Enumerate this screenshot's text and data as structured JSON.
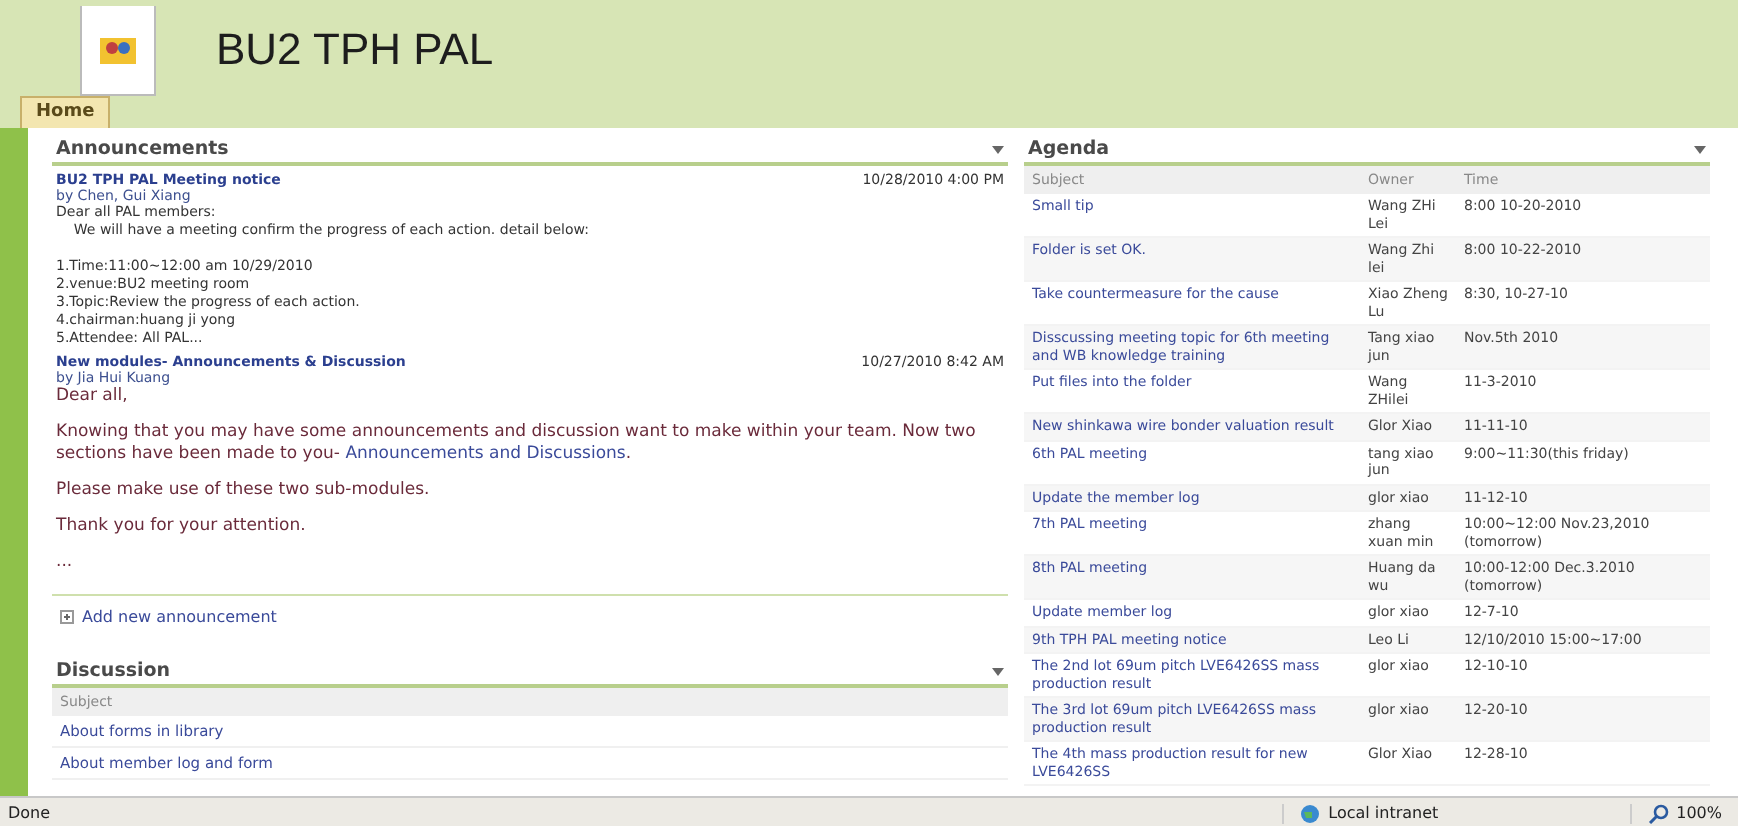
{
  "site": {
    "title": "BU2 TPH PAL"
  },
  "tabs": [
    {
      "label": "Home",
      "selected": true
    }
  ],
  "announcements": {
    "title": "Announcements",
    "items": [
      {
        "title": "BU2 TPH PAL Meeting notice",
        "date": "10/28/2010 4:00 PM",
        "author": "by Chen, Gui Xiang",
        "kind": "small",
        "body": [
          [
            "Dear all PAL members:",
            "    We will have a meeting confirm the progress of each action. detail below:"
          ],
          [
            "1.Time:11:00~12:00 am 10/29/2010",
            "2.venue:BU2 meeting room",
            "3.Topic:Review the progress of each action.",
            "4.chairman:huang ji yong",
            "5.Attendee: All PAL..."
          ]
        ]
      },
      {
        "title": "New modules- Announcements & Discussion",
        "date": "10/27/2010 8:42 AM",
        "author": "by Jia Hui Kuang",
        "kind": "large",
        "body": [
          {
            "text": "Dear all,"
          },
          {
            "text": "Knowing that you may have some announcements and discussion want to make within your team. Now two sections have been made to you- ",
            "link": "Announcements and Discussions",
            "after": "."
          },
          {
            "text": "Please make use of these two sub-modules."
          },
          {
            "text": "Thank you for your attention."
          },
          {
            "text": "..."
          }
        ]
      }
    ],
    "add_link": "Add new announcement"
  },
  "discussion": {
    "title": "Discussion",
    "column": "Subject",
    "rows": [
      "About forms in library",
      "About member log and form"
    ]
  },
  "agenda": {
    "title": "Agenda",
    "columns": [
      "Subject",
      "Owner",
      "Time"
    ],
    "rows": [
      [
        "Small tip",
        "Wang ZHi Lei",
        "8:00 10-20-2010"
      ],
      [
        "Folder is set OK.",
        "Wang Zhi lei",
        "8:00 10-22-2010"
      ],
      [
        "Take countermeasure for the cause",
        "Xiao Zheng Lu",
        "8:30, 10-27-10"
      ],
      [
        "Disscussing meeting topic for 6th meeting and WB knowledge training",
        "Tang xiao jun",
        "Nov.5th 2010"
      ],
      [
        "Put files into the folder",
        "Wang ZHilei",
        "11-3-2010"
      ],
      [
        "New shinkawa wire bonder valuation result",
        "Glor Xiao",
        "11-11-10"
      ],
      [
        "6th PAL meeting",
        "tang xiao jun",
        "9:00~11:30(this friday)"
      ],
      [
        "Update the member log",
        "glor xiao",
        "11-12-10"
      ],
      [
        "7th PAL meeting",
        "zhang xuan min",
        "10:00~12:00  Nov.23,2010 (tomorrow)"
      ],
      [
        "8th PAL meeting",
        "Huang da wu",
        "10:00-12:00 Dec.3.2010 (tomorrow)"
      ],
      [
        "Update member log",
        "glor xiao",
        "12-7-10"
      ],
      [
        "9th TPH PAL meeting notice",
        "Leo Li",
        "12/10/2010 15:00~17:00"
      ],
      [
        "The 2nd lot 69um pitch LVE6426SS mass production result",
        "glor xiao",
        "12-10-10"
      ],
      [
        "The 3rd lot 69um pitch LVE6426SS mass production result",
        "glor xiao",
        "12-20-10"
      ],
      [
        "The 4th mass production result for new LVE6426SS",
        "Glor Xiao",
        "12-28-10"
      ]
    ]
  },
  "status_bar": {
    "status": "Done",
    "zone": "Local intranet",
    "zoom": "100%"
  }
}
